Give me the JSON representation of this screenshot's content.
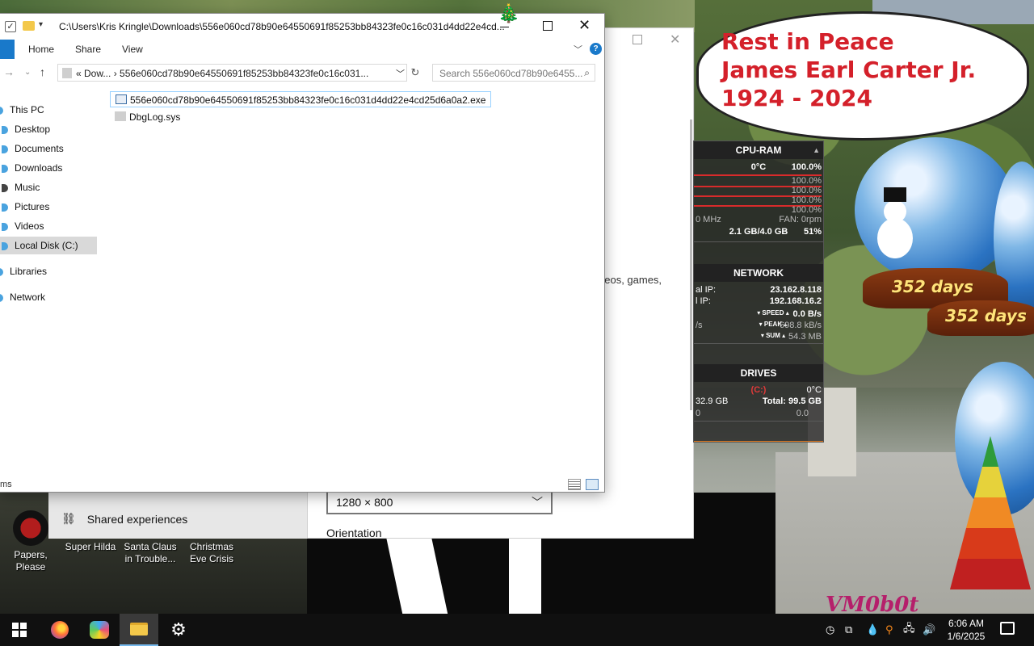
{
  "explorer": {
    "title": "C:\\Users\\Kris Kringle\\Downloads\\556e060cd78b90e64550691f85253bb84323fe0c16c031d4dd22e4cd...",
    "ribbon": {
      "home": "Home",
      "share": "Share",
      "view": "View"
    },
    "address": "«  Dow...  ›  556e060cd78b90e64550691f85253bb84323fe0c16c031...",
    "search_placeholder": "Search 556e060cd78b90e6455...",
    "sidebar": [
      {
        "label": "This PC",
        "color": "#4aa3df"
      },
      {
        "label": "Desktop",
        "color": "#4aa3df"
      },
      {
        "label": "Documents",
        "color": "#4aa3df"
      },
      {
        "label": "Downloads",
        "color": "#4aa3df"
      },
      {
        "label": "Music",
        "color": "#444444"
      },
      {
        "label": "Pictures",
        "color": "#4aa3df"
      },
      {
        "label": "Videos",
        "color": "#4aa3df"
      },
      {
        "label": "Local Disk (C:)",
        "color": "#4aa3df"
      },
      {
        "label": "Libraries",
        "color": "#4aa3df"
      },
      {
        "label": "Network",
        "color": "#4aa3df"
      }
    ],
    "selected_sidebar": "Local Disk (C:)",
    "files": [
      {
        "name": "556e060cd78b90e64550691f85253bb84323fe0c16c031d4dd22e4cd25d6a0a2.exe",
        "icon": "exe-icon"
      },
      {
        "name": "DbgLog.sys",
        "icon": "sys-file-icon"
      }
    ],
    "status": "ms"
  },
  "settings": {
    "partial_text": "deos, games,",
    "resolution": "1280 × 800",
    "orientation": "Orientation",
    "shared_experiences": "Shared experiences"
  },
  "wallpaper": {
    "bubble": [
      "Rest in Peace",
      "James Earl Carter Jr.",
      "1924 - 2024"
    ],
    "days": "352 days",
    "brand": "VM0b0t"
  },
  "gadget": {
    "cpu_header": "CPU-RAM",
    "cpu_temp": "0°C",
    "cpu_total": "100.0%",
    "cores": [
      "100.0%",
      "100.0%",
      "100.0%",
      "100.0%"
    ],
    "mhz": "0 MHz",
    "fan": "FAN: 0rpm",
    "ram": "2.1 GB/4.0 GB",
    "ram_pct": "51%",
    "net_header": "NETWORK",
    "external_ip_label": "al IP:",
    "external_ip": "23.162.8.118",
    "internal_ip_label": "l IP:",
    "internal_ip": "192.168.16.2",
    "speed_label": "▾ SPEED ▴",
    "speed": "0.0 B/s",
    "peak_left": "/s",
    "peak_label": "▾ PEAK ▴",
    "peak": "698.8 kB/s",
    "sum_label": "▾ SUM ▴",
    "sum": "54.3 MB",
    "drives_header": "DRIVES",
    "drive_letter": "(C:)",
    "drive_temp": "0°C",
    "drive_free": "32.9 GB",
    "drive_total": "Total: 99.5 GB",
    "drive_io_left": "0",
    "drive_io": "0.0"
  },
  "desktop_icons": [
    {
      "label": "Papers, Please"
    },
    {
      "label": "Super Hilda"
    },
    {
      "label": "Santa Claus in Trouble..."
    },
    {
      "label": "Christmas Eve Crisis"
    }
  ],
  "taskbar": {
    "time": "6:06 AM",
    "date": "1/6/2025"
  }
}
